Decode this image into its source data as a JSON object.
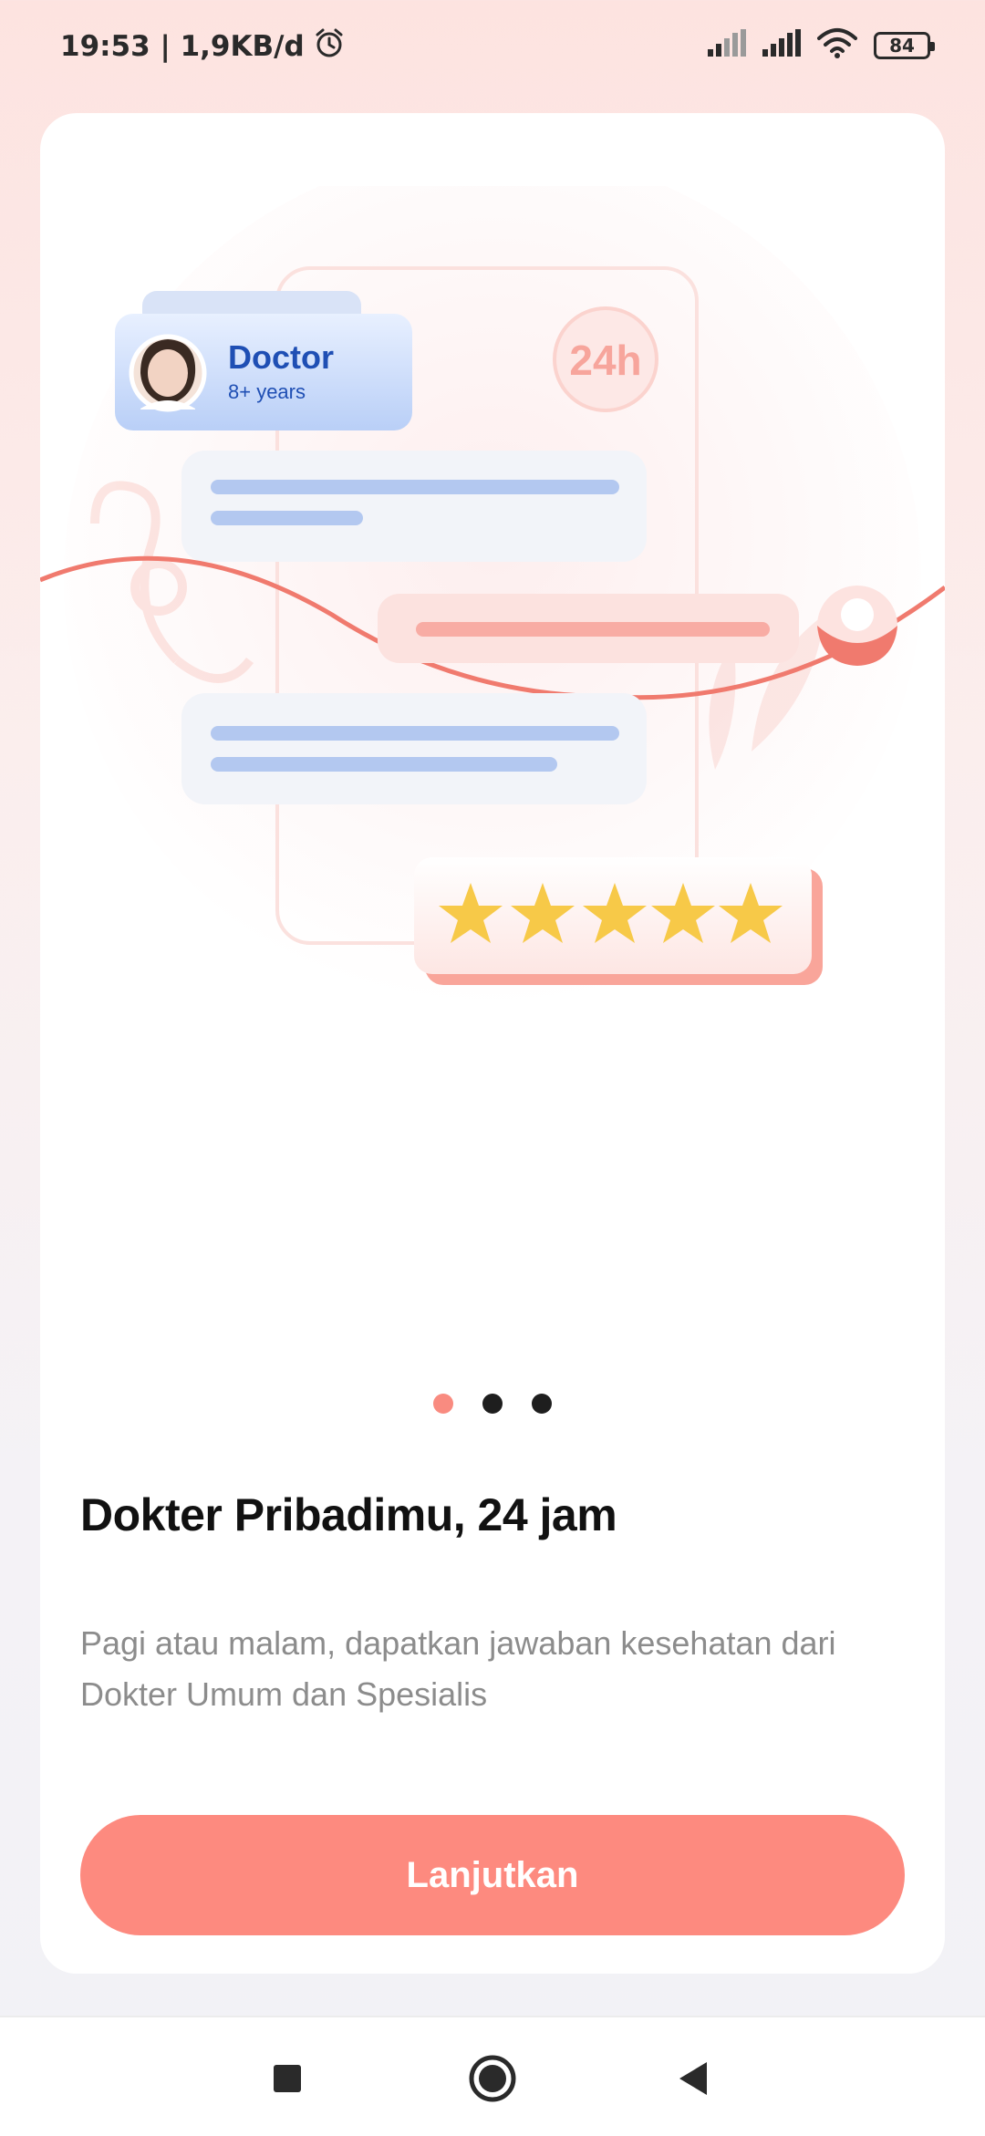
{
  "status_bar": {
    "time_info": "19:53 | 1,9KB/d",
    "battery_level": "84",
    "icons": [
      "alarm-icon",
      "signal-icon",
      "signal-icon",
      "wifi-icon",
      "battery-icon"
    ]
  },
  "illustration": {
    "doctor_title": "Doctor",
    "doctor_experience": "8+ years",
    "badge_24h": "24h",
    "stars_count": 5
  },
  "onboarding": {
    "page_indicator": {
      "total": 3,
      "active_index": 0
    },
    "title": "Dokter Pribadimu, 24 jam",
    "description": "Pagi atau malam, dapatkan jawaban kesehatan dari Dokter Umum dan Spesialis",
    "cta_label": "Lanjutkan"
  },
  "colors": {
    "accent": "#fd8a7f",
    "star": "#f7c948",
    "doctor_blue": "#1f4fb4"
  },
  "nav_bar": {
    "buttons": [
      "recents-square-icon",
      "home-circle-icon",
      "back-triangle-icon"
    ]
  }
}
